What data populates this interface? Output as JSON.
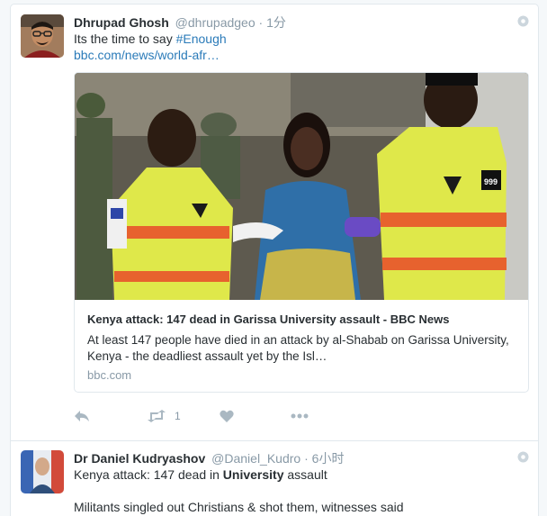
{
  "tweets": [
    {
      "fullname": "Dhrupad Ghosh",
      "username": "@dhrupadgeo",
      "separator": "·",
      "time": "1分",
      "text_plain": "Its the time to say ",
      "hashtag": "#Enough",
      "link": "bbc.com/news/world-afr…",
      "card": {
        "title": "Kenya attack: 147 dead in Garissa University assault - BBC News",
        "description": "At least 147 people have died in an attack by al-Shabab on Garissa University, Kenya - the deadliest assault yet by the Isl…",
        "domain": "bbc.com",
        "vest_badge": "999"
      },
      "actions": {
        "reply_icon": "reply-icon",
        "retweet_icon": "retweet-icon",
        "retweet_count": "1",
        "like_icon": "heart-icon",
        "more_icon": "more-icon"
      }
    },
    {
      "fullname": "Dr Daniel Kudryashov",
      "username": "@Daniel_Kudro",
      "separator": "·",
      "time": "6小时",
      "text_part1": "Kenya attack: 147 dead in ",
      "text_bold": "University",
      "text_part2": " assault",
      "text_line2": "Militants singled out Christians & shot them, witnesses said"
    }
  ],
  "colors": {
    "link": "#2b7bb9",
    "meta": "#8899a6",
    "icon": "#aab8c2",
    "border": "#e1e8ed"
  }
}
